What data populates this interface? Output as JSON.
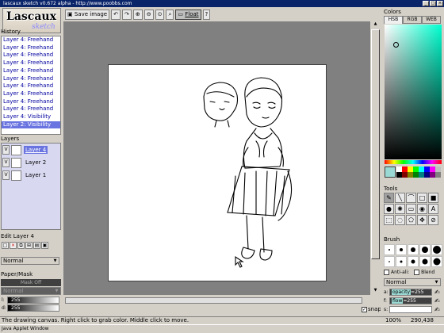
{
  "window": {
    "title": "lascaux sketch v0.672 alpha - http://www.poobbs.com"
  },
  "logo": {
    "name": "Lascaux",
    "sub": "sketch"
  },
  "history": {
    "label": "History",
    "items": [
      "Layer 4: Freehand",
      "Layer 4: Freehand",
      "Layer 4: Freehand",
      "Layer 4: Freehand",
      "Layer 4: Freehand",
      "Layer 4: Freehand",
      "Layer 4: Freehand",
      "Layer 4: Freehand",
      "Layer 4: Freehand",
      "Layer 4: Freehand",
      "Layer 4: Visibility",
      "Layer 2: Visibility"
    ]
  },
  "layers": {
    "label": "Layers",
    "items": [
      {
        "name": "Layer 4"
      },
      {
        "name": "Layer 2"
      },
      {
        "name": "Layer 1"
      }
    ]
  },
  "edit_layer": {
    "label": "Edit Layer 4",
    "blend": "Normal"
  },
  "paper_mask": {
    "label": "Paper/Mask",
    "mask_button": "Mask Off",
    "mode": "Normal",
    "l_label": "l:",
    "l_value": "255",
    "d_label": "d:",
    "d_value": "255"
  },
  "toolbar": {
    "save_label": "Save image",
    "float_label": "Float"
  },
  "snap": {
    "label": "snap",
    "checked": true
  },
  "colors": {
    "label": "Colors",
    "tabs": [
      "HSB",
      "RGB",
      "WEB"
    ],
    "current": "#9bdad4",
    "palette": [
      "#ffffff",
      "#ff0000",
      "#ffff00",
      "#00ff00",
      "#00ffff",
      "#0000ff",
      "#ff00ff",
      "#c0c0c0",
      "#000000",
      "#800000",
      "#808000",
      "#008000",
      "#008080",
      "#000080",
      "#800080",
      "#808080"
    ]
  },
  "tools": {
    "label": "Tools"
  },
  "brush": {
    "label": "Brush",
    "antialias": "Anti-ali:",
    "blend_label": "Blend",
    "mode": "Normal",
    "a_label": "a:",
    "opacity_label": "opacity",
    "opacity": "255",
    "f_label": "f:",
    "flow_label": "flow",
    "flow": "255",
    "s_label": "s:"
  },
  "status": {
    "message": "The drawing canvas. Right click to grab color. Middle click to move.",
    "zoom": "100%",
    "coords": "290,438"
  },
  "applet_window": "Java Applet Window"
}
